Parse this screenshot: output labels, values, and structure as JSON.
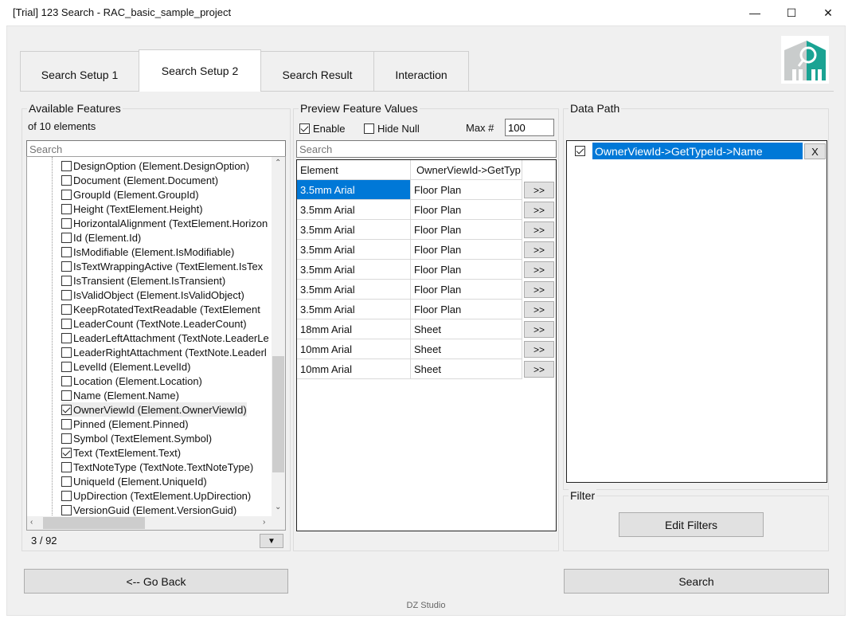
{
  "window": {
    "title": "[Trial] 123 Search - RAC_basic_sample_project",
    "minimize": "—",
    "maximize": "☐",
    "close": "✕"
  },
  "tabs": [
    {
      "label": "Search Setup 1"
    },
    {
      "label": "Search Setup 2"
    },
    {
      "label": "Search Result"
    },
    {
      "label": "Interaction"
    }
  ],
  "features": {
    "title": "Available Features",
    "count_text": "of 10 elements",
    "search_placeholder": "Search",
    "items": [
      {
        "label": "DesignOption (Element.DesignOption)",
        "checked": false
      },
      {
        "label": "Document (Element.Document)",
        "checked": false
      },
      {
        "label": "GroupId (Element.GroupId)",
        "checked": false
      },
      {
        "label": "Height (TextElement.Height)",
        "checked": false
      },
      {
        "label": "HorizontalAlignment (TextElement.Horizon",
        "checked": false
      },
      {
        "label": "Id (Element.Id)",
        "checked": false
      },
      {
        "label": "IsModifiable (Element.IsModifiable)",
        "checked": false
      },
      {
        "label": "IsTextWrappingActive (TextElement.IsTex",
        "checked": false
      },
      {
        "label": "IsTransient (Element.IsTransient)",
        "checked": false
      },
      {
        "label": "IsValidObject (Element.IsValidObject)",
        "checked": false
      },
      {
        "label": "KeepRotatedTextReadable (TextElement",
        "checked": false
      },
      {
        "label": "LeaderCount (TextNote.LeaderCount)",
        "checked": false
      },
      {
        "label": "LeaderLeftAttachment (TextNote.LeaderLe",
        "checked": false
      },
      {
        "label": "LeaderRightAttachment (TextNote.Leaderl",
        "checked": false
      },
      {
        "label": "LevelId (Element.LevelId)",
        "checked": false
      },
      {
        "label": "Location (Element.Location)",
        "checked": false
      },
      {
        "label": "Name (Element.Name)",
        "checked": false
      },
      {
        "label": "OwnerViewId (Element.OwnerViewId)",
        "checked": true,
        "selected": true
      },
      {
        "label": "Pinned (Element.Pinned)",
        "checked": false
      },
      {
        "label": "Symbol (TextElement.Symbol)",
        "checked": false
      },
      {
        "label": "Text (TextElement.Text)",
        "checked": true
      },
      {
        "label": "TextNoteType (TextNote.TextNoteType)",
        "checked": false
      },
      {
        "label": "UniqueId (Element.UniqueId)",
        "checked": false
      },
      {
        "label": "UpDirection (TextElement.UpDirection)",
        "checked": false
      },
      {
        "label": "VersionGuid (Element.VersionGuid)",
        "checked": false
      }
    ],
    "pager": "3 / 92",
    "pager_dropdown": "▼"
  },
  "preview": {
    "title": "Preview Feature Values",
    "enable_label": "Enable",
    "enable_checked": true,
    "hidenull_label": "Hide Null",
    "hidenull_checked": false,
    "max_label": "Max #",
    "max_value": "100",
    "search_placeholder": "Search",
    "columns": [
      "Element",
      "OwnerViewId->GetTyp"
    ],
    "rows": [
      {
        "element": "3.5mm Arial",
        "value": "Floor Plan",
        "btn": ">>"
      },
      {
        "element": "3.5mm Arial",
        "value": "Floor Plan",
        "btn": ">>"
      },
      {
        "element": "3.5mm Arial",
        "value": "Floor Plan",
        "btn": ">>"
      },
      {
        "element": "3.5mm Arial",
        "value": "Floor Plan",
        "btn": ">>"
      },
      {
        "element": "3.5mm Arial",
        "value": "Floor Plan",
        "btn": ">>"
      },
      {
        "element": "3.5mm Arial",
        "value": "Floor Plan",
        "btn": ">>"
      },
      {
        "element": "3.5mm Arial",
        "value": "Floor Plan",
        "btn": ">>"
      },
      {
        "element": "18mm Arial",
        "value": "Sheet",
        "btn": ">>"
      },
      {
        "element": "10mm Arial",
        "value": "Sheet",
        "btn": ">>"
      },
      {
        "element": "10mm Arial",
        "value": "Sheet",
        "btn": ">>"
      }
    ]
  },
  "datapath": {
    "title": "Data Path",
    "items": [
      {
        "label": "OwnerViewId->GetTypeId->Name",
        "checked": true,
        "remove": "X"
      }
    ]
  },
  "filter": {
    "title": "Filter",
    "edit_label": "Edit Filters"
  },
  "actions": {
    "back_label": "<-- Go Back",
    "search_label": "Search"
  },
  "footer": "DZ Studio",
  "colors": {
    "accent": "#0078d7",
    "logo_teal": "#1aa393"
  }
}
